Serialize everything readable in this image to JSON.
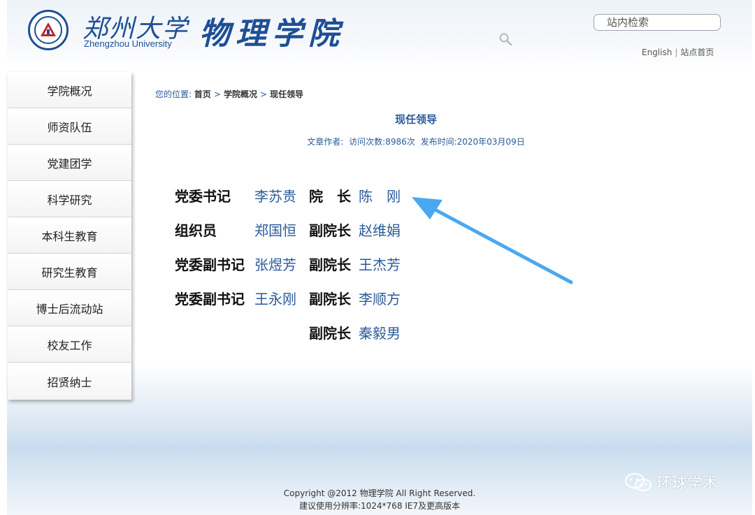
{
  "header": {
    "university_cn": "郑州大学",
    "university_en": "Zhengzhou University",
    "college_name": "物理学院",
    "search_placeholder": "站内检索",
    "links": {
      "english": "English",
      "separator": "|",
      "home": "站点首页"
    }
  },
  "sidebar": {
    "items": [
      {
        "label": "学院概况"
      },
      {
        "label": "师资队伍"
      },
      {
        "label": "党建团学"
      },
      {
        "label": "科学研究"
      },
      {
        "label": "本科生教育"
      },
      {
        "label": "研究生教育"
      },
      {
        "label": "博士后流动站"
      },
      {
        "label": "校友工作"
      },
      {
        "label": "招贤纳士"
      }
    ]
  },
  "breadcrumb": {
    "prefix": "您的位置:",
    "items": [
      "首页",
      "学院概况",
      "现任领导"
    ],
    "separator": ">"
  },
  "article": {
    "title": "现任领导",
    "meta": {
      "author": "文章作者:",
      "visits": "访问次数:8986次",
      "published": "发布时间:2020年03月09日"
    }
  },
  "leaders": [
    {
      "role_left": "党委书记",
      "name_left": "李苏贵",
      "role_right": "院　长",
      "name_right": "陈　刚"
    },
    {
      "role_left": "组织员",
      "name_left": "郑国恒",
      "role_right": "副院长",
      "name_right": "赵维娟"
    },
    {
      "role_left": "党委副书记",
      "name_left": "张煜芳",
      "role_right": "副院长",
      "name_right": "王杰芳"
    },
    {
      "role_left": "党委副书记",
      "name_left": "王永刚",
      "role_right": "副院长",
      "name_right": "李顺方"
    },
    {
      "role_left": "",
      "name_left": "",
      "role_right": "副院长",
      "name_right": "秦毅男"
    }
  ],
  "footer": {
    "copyright": "Copyright @2012 物理学院 All Right Reserved.",
    "resolution": "建议使用分辨率:1024*768 IE7及更高版本"
  },
  "watermark": {
    "text": "环球学术"
  },
  "colors": {
    "brand_blue": "#1d4f95",
    "link_blue": "#2a5a9a",
    "arrow_blue": "#4aa8f0"
  }
}
